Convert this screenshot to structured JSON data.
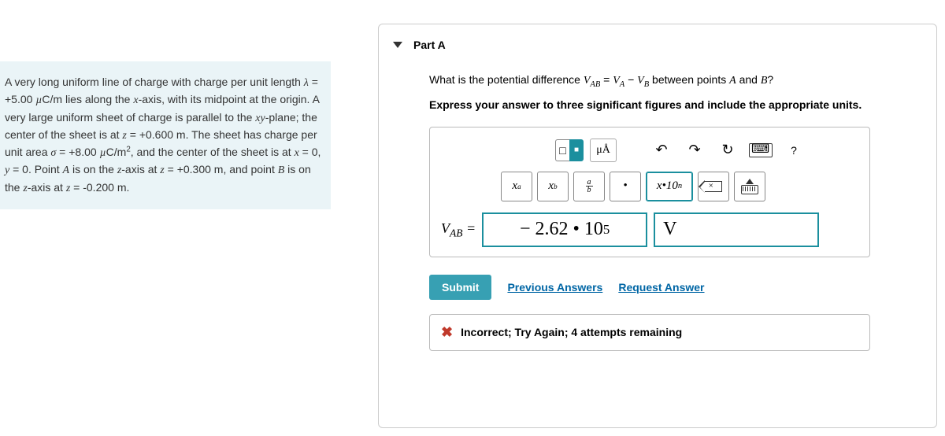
{
  "problem": {
    "html": "A very long uniform line of charge with charge per unit length <span class='ital'>λ</span> = +5.00 <span class='ital'>µ</span>C/m lies along the <span class='ital'>x</span>-axis, with its midpoint at the origin. A very large uniform sheet of charge is parallel to the <span class='ital'>xy</span>-plane; the center of the sheet is at <span class='ital'>z</span> = +0.600 m. The sheet has charge per unit area <span class='ital'>σ</span> = +8.00 <span class='ital'>µ</span>C/m<sup>2</sup>, and the center of the sheet is at <span class='ital'>x</span> = 0, <span class='ital'>y</span> = 0. Point <span class='ital'>A</span> is on the <span class='ital'>z</span>-axis at <span class='ital'>z</span> = +0.300 m, and point <span class='ital'>B</span> is on the <span class='ital'>z</span>-axis at <span class='ital'>z</span> = -0.200 m."
  },
  "part": {
    "label": "Part A"
  },
  "question": {
    "line1_html": "What is the potential difference <span class='ital'>V<sub>AB</sub></span> = <span class='ital'>V<sub>A</sub></span> − <span class='ital'>V<sub>B</sub></span> between points <span class='ital'>A</span> and <span class='ital'>B</span>?",
    "line2": "Express your answer to three significant figures and include the appropriate units."
  },
  "toolbar": {
    "units_label": "μÅ",
    "help": "?",
    "xa": "x",
    "xa_sup": "a",
    "xb": "x",
    "xb_sub": "b",
    "frac_a": "a",
    "frac_b": "b",
    "dot": "•",
    "sci_html": "x•10<sup>n</sup>"
  },
  "answer": {
    "lhs_html": "V<sub>AB</sub> =",
    "value_html": "− 2.62 • 10<sup>5</sup>",
    "unit": "V"
  },
  "actions": {
    "submit": "Submit",
    "previous": "Previous Answers",
    "request": "Request Answer"
  },
  "feedback": {
    "text": "Incorrect; Try Again; 4 attempts remaining"
  }
}
